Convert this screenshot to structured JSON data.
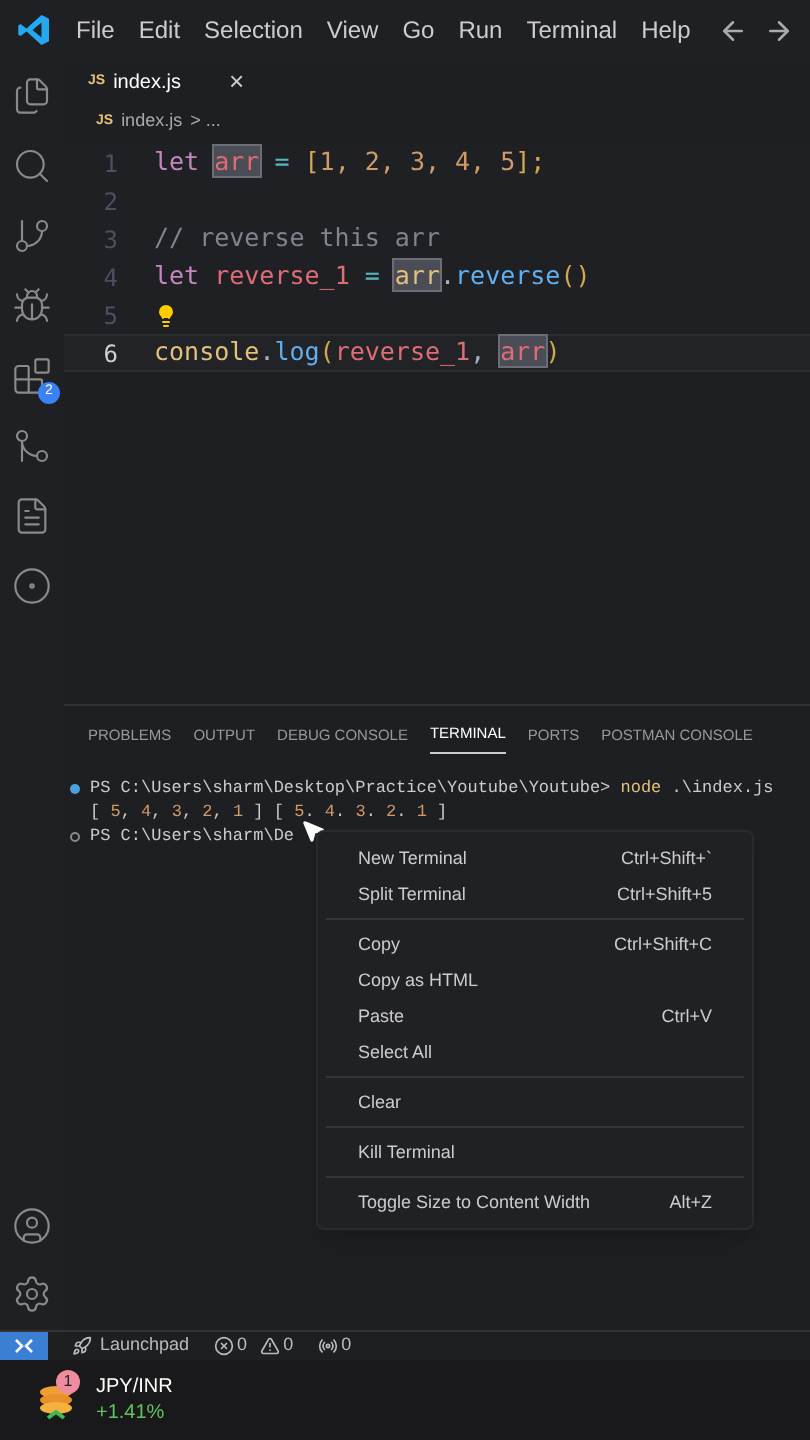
{
  "menu": [
    "File",
    "Edit",
    "Selection",
    "View",
    "Go",
    "Run",
    "Terminal",
    "Help"
  ],
  "activity_badge": "2",
  "tab": {
    "label": "index.js",
    "close": "×",
    "file_icon": "JS"
  },
  "breadcrumb": {
    "file_icon": "JS",
    "file": "index.js",
    "rest": "> ..."
  },
  "code": [
    {
      "number": "1",
      "current": false,
      "lightbulb": false,
      "tokens": [
        {
          "text": "let ",
          "kind": "keyword",
          "highlighted": false
        },
        {
          "text": "arr",
          "kind": "variable",
          "highlighted": true
        },
        {
          "text": " = ",
          "kind": "operator",
          "highlighted": false
        },
        {
          "text": "[",
          "kind": "punct",
          "highlighted": false
        },
        {
          "text": "1, 2, 3, 4, 5",
          "kind": "number",
          "highlighted": false
        },
        {
          "text": "];",
          "kind": "punct",
          "highlighted": false
        }
      ]
    },
    {
      "number": "2",
      "current": false,
      "lightbulb": false
    },
    {
      "number": "3",
      "current": false,
      "lightbulb": false,
      "tokens": [
        {
          "text": "// reverse this arr",
          "kind": "comment",
          "highlighted": false
        }
      ]
    },
    {
      "number": "4",
      "current": false,
      "lightbulb": false,
      "tokens": [
        {
          "text": "let ",
          "kind": "keyword",
          "highlighted": false
        },
        {
          "text": "reverse_1",
          "kind": "variable",
          "highlighted": false
        },
        {
          "text": " = ",
          "kind": "operator",
          "highlighted": false
        },
        {
          "text": "arr",
          "kind": "object",
          "highlighted": true
        },
        {
          "text": ".",
          "kind": "plain",
          "highlighted": false
        },
        {
          "text": "reverse",
          "kind": "function",
          "highlighted": false
        },
        {
          "text": "()",
          "kind": "punct",
          "highlighted": false
        }
      ]
    },
    {
      "number": "5",
      "current": false,
      "lightbulb": true
    },
    {
      "number": "6",
      "current": true,
      "lightbulb": false,
      "tokens": [
        {
          "text": "console",
          "kind": "object",
          "highlighted": false
        },
        {
          "text": ".",
          "kind": "plain",
          "highlighted": false
        },
        {
          "text": "log",
          "kind": "function",
          "highlighted": false
        },
        {
          "text": "(",
          "kind": "punct",
          "highlighted": false
        },
        {
          "text": "reverse_1",
          "kind": "variable",
          "highlighted": false
        },
        {
          "text": ", ",
          "kind": "plain",
          "highlighted": false
        },
        {
          "text": "arr",
          "kind": "variable",
          "highlighted": true
        },
        {
          "text": ")",
          "kind": "punct",
          "highlighted": false
        }
      ]
    }
  ],
  "panel_tabs": [
    {
      "label": "PROBLEMS",
      "selected": false
    },
    {
      "label": "OUTPUT",
      "selected": false
    },
    {
      "label": "DEBUG CONSOLE",
      "selected": false
    },
    {
      "label": "TERMINAL",
      "selected": true
    },
    {
      "label": "PORTS",
      "selected": false
    },
    {
      "label": "POSTMAN CONSOLE",
      "selected": false
    }
  ],
  "terminal": [
    {
      "kind": "success",
      "tokens": [
        {
          "text": "PS C:\\Users\\sharm\\Desktop\\Practice\\Youtube\\Youtube> ",
          "kind": "plain"
        },
        {
          "text": "node",
          "kind": "command"
        },
        {
          "text": " .\\index.js",
          "kind": "plain"
        }
      ]
    },
    {
      "kind": "output",
      "tokens": [
        {
          "text": "[ ",
          "kind": "plain"
        },
        {
          "text": "5",
          "kind": "number"
        },
        {
          "text": ", ",
          "kind": "plain"
        },
        {
          "text": "4",
          "kind": "number"
        },
        {
          "text": ", ",
          "kind": "plain"
        },
        {
          "text": "3",
          "kind": "number"
        },
        {
          "text": ", ",
          "kind": "plain"
        },
        {
          "text": "2",
          "kind": "number"
        },
        {
          "text": ", ",
          "kind": "plain"
        },
        {
          "text": "1",
          "kind": "number"
        },
        {
          "text": " ] [ ",
          "kind": "plain"
        },
        {
          "text": "5",
          "kind": "number"
        },
        {
          "text": ". ",
          "kind": "plain"
        },
        {
          "text": "4",
          "kind": "number"
        },
        {
          "text": ". ",
          "kind": "plain"
        },
        {
          "text": "3",
          "kind": "number"
        },
        {
          "text": ". ",
          "kind": "plain"
        },
        {
          "text": "2",
          "kind": "number"
        },
        {
          "text": ". ",
          "kind": "plain"
        },
        {
          "text": "1",
          "kind": "number"
        },
        {
          "text": " ]",
          "kind": "plain"
        }
      ]
    },
    {
      "kind": "prompt",
      "tokens": [
        {
          "text": "PS C:\\Users\\sharm\\De",
          "kind": "plain"
        }
      ]
    }
  ],
  "context_menu": [
    {
      "kind": "item",
      "label": "New Terminal",
      "shortcut": "Ctrl+Shift+`"
    },
    {
      "kind": "item",
      "label": "Split Terminal",
      "shortcut": "Ctrl+Shift+5"
    },
    {
      "kind": "separator"
    },
    {
      "kind": "item",
      "label": "Copy",
      "shortcut": "Ctrl+Shift+C"
    },
    {
      "kind": "item",
      "label": "Copy as HTML"
    },
    {
      "kind": "item",
      "label": "Paste",
      "shortcut": "Ctrl+V"
    },
    {
      "kind": "item",
      "label": "Select All"
    },
    {
      "kind": "separator"
    },
    {
      "kind": "item",
      "label": "Clear"
    },
    {
      "kind": "separator"
    },
    {
      "kind": "item",
      "label": "Kill Terminal"
    },
    {
      "kind": "separator"
    },
    {
      "kind": "item",
      "label": "Toggle Size to Content Width",
      "shortcut": "Alt+Z"
    }
  ],
  "status_bar": {
    "launchpad": "Launchpad",
    "errors": "0",
    "warnings": "0",
    "ports": "0"
  },
  "ticker": {
    "badge": "1",
    "pair": "JPY/INR",
    "change": "+1.41%"
  }
}
